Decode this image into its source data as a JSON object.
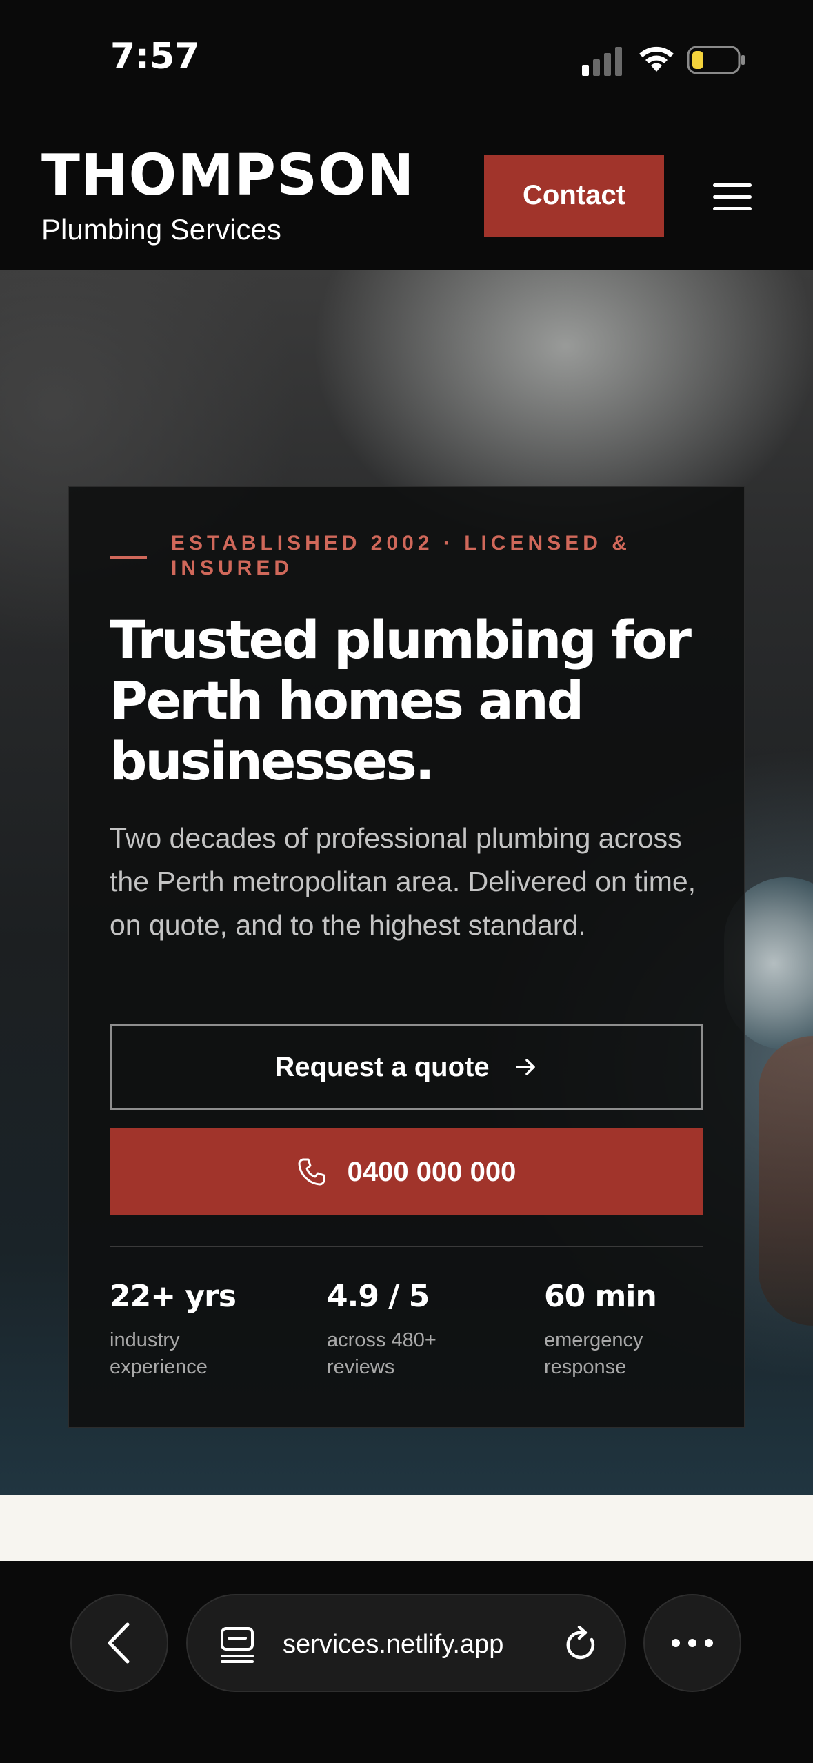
{
  "status_bar": {
    "time": "7:57"
  },
  "header": {
    "brand_name": "THOMPSON",
    "brand_sub": "Plumbing Services",
    "contact_label": "Contact",
    "menu_icon": "hamburger-menu-icon"
  },
  "hero": {
    "eyebrow": "ESTABLISHED 2002 · LICENSED & INSURED",
    "title": "Trusted plumbing for Perth homes and businesses.",
    "description": "Two decades of professional plumbing across the Perth metropolitan area. Delivered on time, on quote, and to the highest standard.",
    "quote_button_label": "Request a quote",
    "phone_button_label": "0400 000 000",
    "stats": [
      {
        "value": "22+ yrs",
        "label": "industry experience"
      },
      {
        "value": "4.9 / 5",
        "label": "across 480+ reviews"
      },
      {
        "value": "60 min",
        "label": "emergency response"
      }
    ]
  },
  "browser": {
    "url": "services.netlify.app"
  },
  "colors": {
    "accent": "#a1342b",
    "eyebrow": "#d0685a",
    "background": "#0a0a0a",
    "section_light": "#f7f5f0"
  }
}
